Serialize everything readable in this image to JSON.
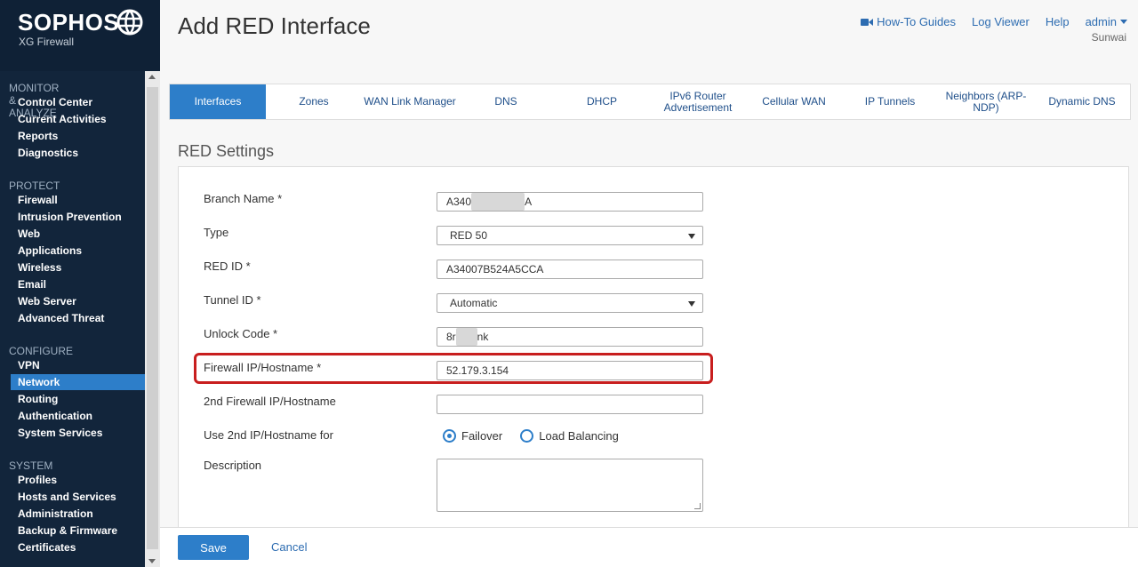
{
  "brand": {
    "logo": "SOPHOS",
    "product": "XG Firewall",
    "globe_icon": "globe-icon"
  },
  "sidebar": {
    "sections": [
      {
        "title": "MONITOR & ANALYZE",
        "items": [
          "Control Center",
          "Current Activities",
          "Reports",
          "Diagnostics"
        ]
      },
      {
        "title": "PROTECT",
        "items": [
          "Firewall",
          "Intrusion Prevention",
          "Web",
          "Applications",
          "Wireless",
          "Email",
          "Web Server",
          "Advanced Threat"
        ]
      },
      {
        "title": "CONFIGURE",
        "items": [
          "VPN",
          "Network",
          "Routing",
          "Authentication",
          "System Services"
        ]
      },
      {
        "title": "SYSTEM",
        "items": [
          "Profiles",
          "Hosts and Services",
          "Administration",
          "Backup & Firmware",
          "Certificates"
        ]
      }
    ],
    "active_item": "Network",
    "active_color": "#2d7ec9"
  },
  "header": {
    "title": "Add RED Interface",
    "links": {
      "howto": "How-To Guides",
      "logviewer": "Log Viewer",
      "help": "Help",
      "admin": "admin"
    },
    "subuser": "Sunwai"
  },
  "tabs": [
    {
      "label": "Interfaces",
      "active": true
    },
    {
      "label": "Zones"
    },
    {
      "label": "WAN Link Manager"
    },
    {
      "label": "DNS"
    },
    {
      "label": "DHCP"
    },
    {
      "label": "IPv6 Router Advertisement"
    },
    {
      "label": "Cellular WAN"
    },
    {
      "label": "IP Tunnels"
    },
    {
      "label": "Neighbors (ARP-NDP)"
    },
    {
      "label": "Dynamic DNS"
    }
  ],
  "form": {
    "section_title": "RED Settings",
    "branch_name": {
      "label": "Branch Name *",
      "value_prefix": "A340",
      "value_suffix": "A"
    },
    "type": {
      "label": "Type",
      "value": "RED 50"
    },
    "red_id": {
      "label": "RED ID *",
      "value": "A34007B524A5CCA"
    },
    "tunnel_id": {
      "label": "Tunnel ID *",
      "value": "Automatic"
    },
    "unlock_code": {
      "label": "Unlock Code *",
      "value_prefix": "8r",
      "value_suffix": "nk"
    },
    "firewall_ip": {
      "label": "Firewall IP/Hostname *",
      "value": "52.179.3.154"
    },
    "second_firewall_ip": {
      "label": "2nd Firewall IP/Hostname",
      "value": ""
    },
    "use_2nd_for": {
      "label": "Use 2nd IP/Hostname for",
      "options": [
        "Failover",
        "Load Balancing"
      ],
      "selected": "Failover"
    },
    "description": {
      "label": "Description",
      "value": ""
    }
  },
  "footer": {
    "save": "Save",
    "cancel": "Cancel"
  },
  "colors": {
    "highlight": "#c81e1e",
    "primary": "#2d7ec9",
    "sidebar": "#12253b"
  }
}
